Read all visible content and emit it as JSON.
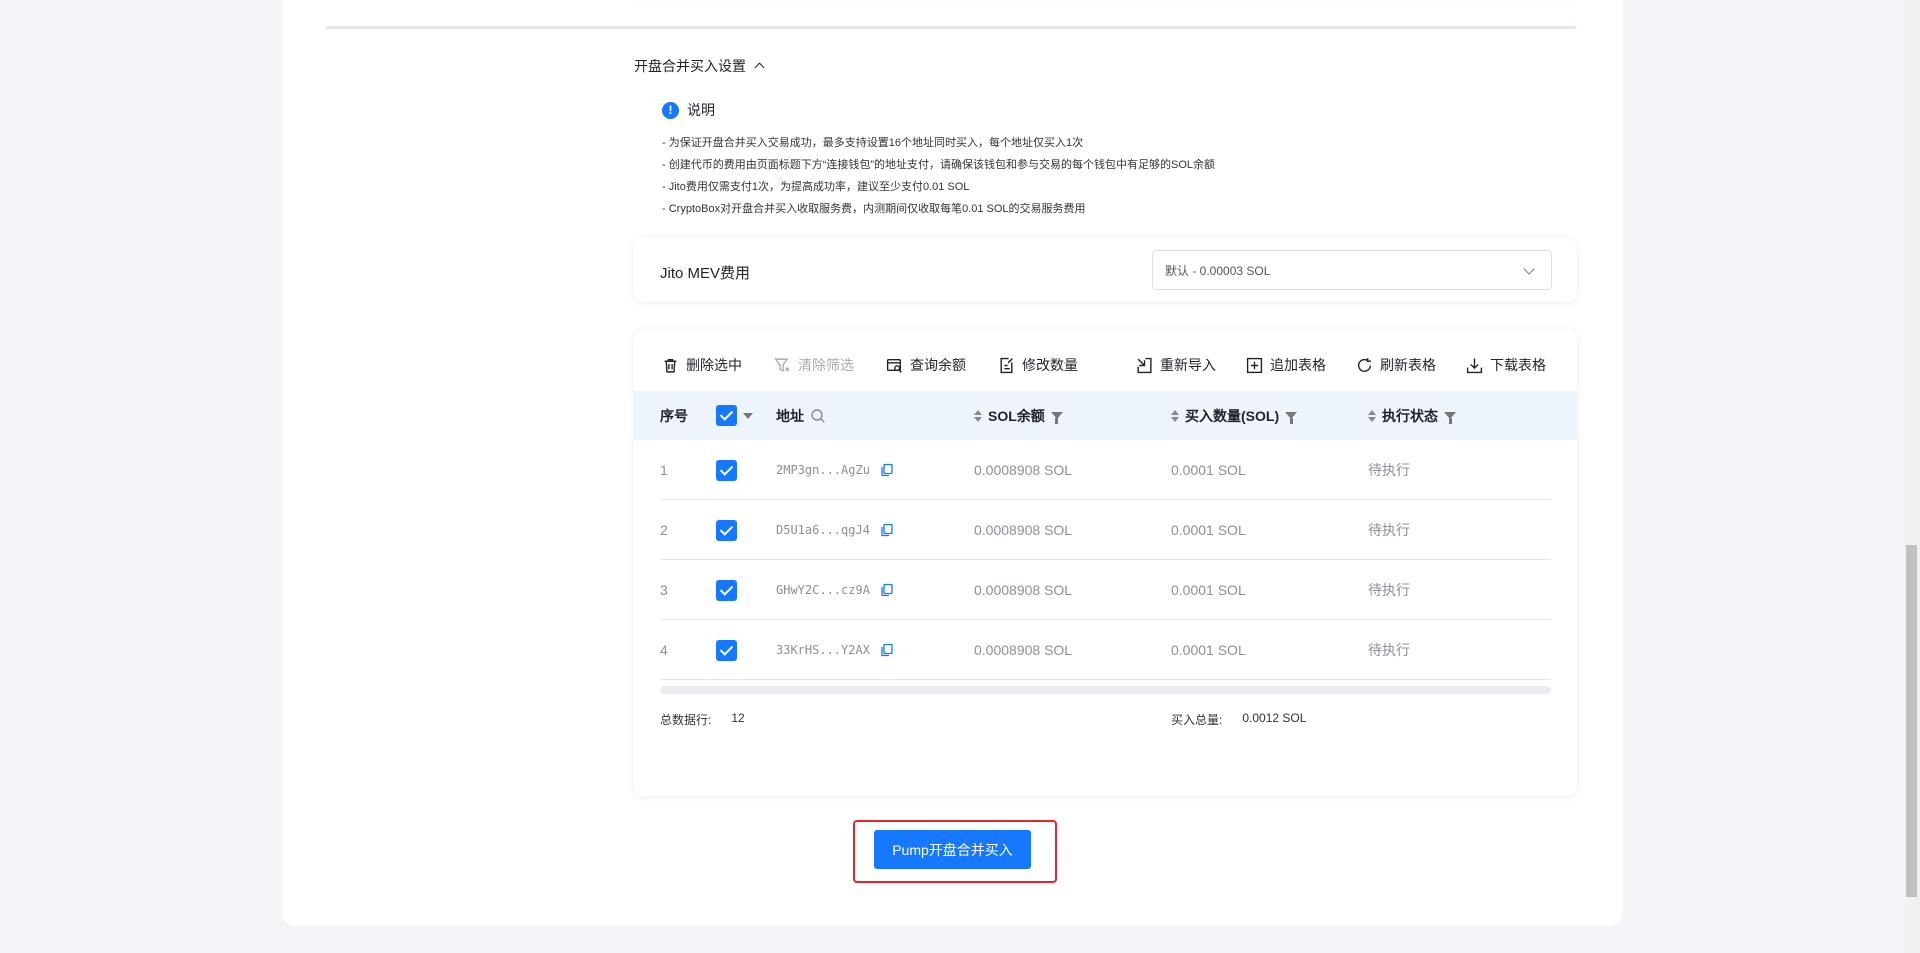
{
  "section": {
    "title": "开盘合并买入设置"
  },
  "notice": {
    "title": "说明",
    "lines": [
      "- 为保证开盘合并买入交易成功，最多支持设置16个地址同时买入，每个地址仅买入1次",
      "- 创建代币的费用由页面标题下方“连接钱包”的地址支付，请确保该钱包和参与交易的每个钱包中有足够的SOL余额",
      "- Jito费用仅需支付1次，为提高成功率，建议至少支付0.01 SOL",
      "- CryptoBox对开盘合并买入收取服务费，内测期间仅收取每笔0.01 SOL的交易服务费用"
    ]
  },
  "fee": {
    "label": "Jito MEV费用",
    "selected": "默认 - 0.00003 SOL"
  },
  "toolbar": {
    "delete_selected": "删除选中",
    "clear_filter": "清除筛选",
    "query_balance": "查询余额",
    "modify_quantity": "修改数量",
    "reimport": "重新导入",
    "append_table": "追加表格",
    "refresh_table": "刷新表格",
    "download_table": "下载表格"
  },
  "table": {
    "headers": {
      "index": "序号",
      "address": "地址",
      "balance": "SOL余额",
      "buy_amount": "买入数量(SOL)",
      "status": "执行状态"
    },
    "rows": [
      {
        "index": "1",
        "address": "2MP3gn...AgZu",
        "balance": "0.0008908 SOL",
        "buy": "0.0001 SOL",
        "status": "待执行"
      },
      {
        "index": "2",
        "address": "D5U1a6...qgJ4",
        "balance": "0.0008908 SOL",
        "buy": "0.0001 SOL",
        "status": "待执行"
      },
      {
        "index": "3",
        "address": "GHwY2C...cz9A",
        "balance": "0.0008908 SOL",
        "buy": "0.0001 SOL",
        "status": "待执行"
      },
      {
        "index": "4",
        "address": "33KrHS...Y2AX",
        "balance": "0.0008908 SOL",
        "buy": "0.0001 SOL",
        "status": "待执行"
      }
    ],
    "footer": {
      "total_rows_label": "总数据行:",
      "total_rows": "12",
      "total_buy_label": "买入总量:",
      "total_buy": "0.0012 SOL"
    }
  },
  "submit": {
    "label": "Pump开盘合并买入"
  },
  "colors": {
    "primary": "#1677ff",
    "highlight": "#e5242b"
  }
}
